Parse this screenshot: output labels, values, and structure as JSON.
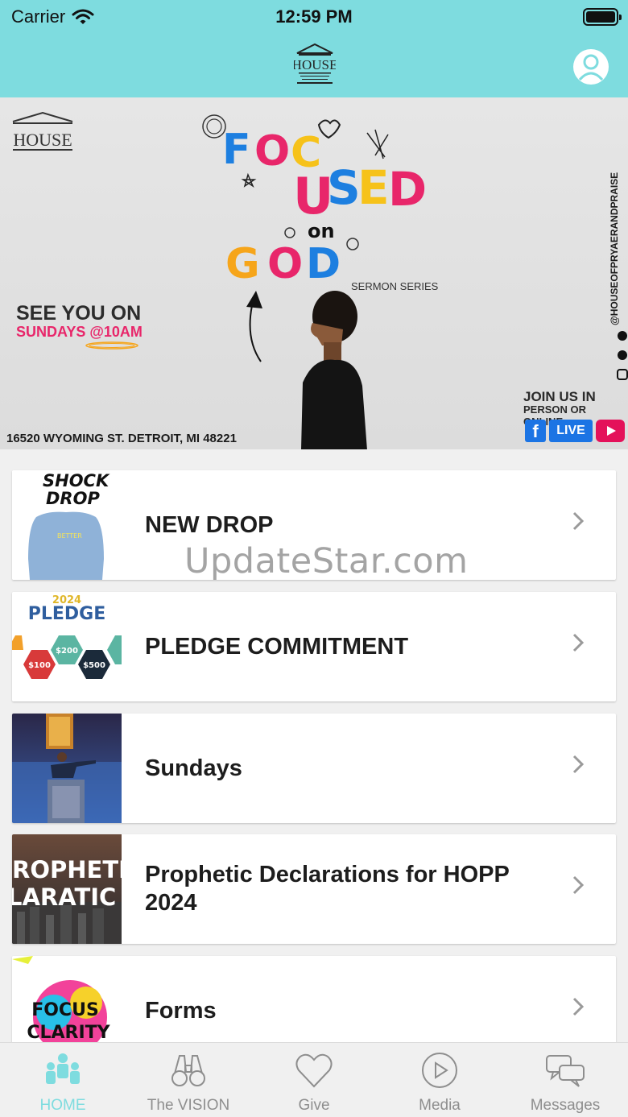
{
  "status_bar": {
    "carrier": "Carrier",
    "time": "12:59 PM"
  },
  "header": {
    "logo_icon": "house-logo",
    "profile_icon": "user-icon"
  },
  "banner": {
    "logo_text": "HOUSE",
    "see_you_on": "SEE YOU ON",
    "sundays_time": "SUNDAYS @10AM",
    "series_title": "FOCUSED ON GOD",
    "sermon_series": "SERMON SERIES",
    "address": "16520 WYOMING ST. DETROIT, MI 48221",
    "join_line1": "JOIN US IN",
    "join_line2": "PERSON OR ONLINE",
    "live_label": "LIVE",
    "social_handle": "@HOUSEOFPRYAERANDPRAISE"
  },
  "list": [
    {
      "title": "NEW DROP",
      "thumb_text": "SHOCK DROP"
    },
    {
      "title": "PLEDGE COMMITMENT",
      "thumb_text": "PLEDGE",
      "thumb_year": "2024"
    },
    {
      "title": "Sundays"
    },
    {
      "title": "Prophetic Declarations for HOPP 2024",
      "thumb_text": "ROPHETI LARATIC"
    },
    {
      "title": "Forms",
      "thumb_text": "FOCUS CLARITY"
    }
  ],
  "watermark": "UpdateStar.com",
  "tabbar": {
    "tabs": [
      {
        "label": "HOME",
        "icon": "people-icon",
        "active": true
      },
      {
        "label": "The VISION",
        "icon": "binoculars-icon",
        "active": false
      },
      {
        "label": "Give",
        "icon": "heart-icon",
        "active": false
      },
      {
        "label": "Media",
        "icon": "play-icon",
        "active": false
      },
      {
        "label": "Messages",
        "icon": "chat-icon",
        "active": false
      }
    ]
  },
  "colors": {
    "accent": "#7edcdf",
    "pink": "#e8266a",
    "blue": "#1b74e4",
    "inactive": "#8e8e8e"
  }
}
